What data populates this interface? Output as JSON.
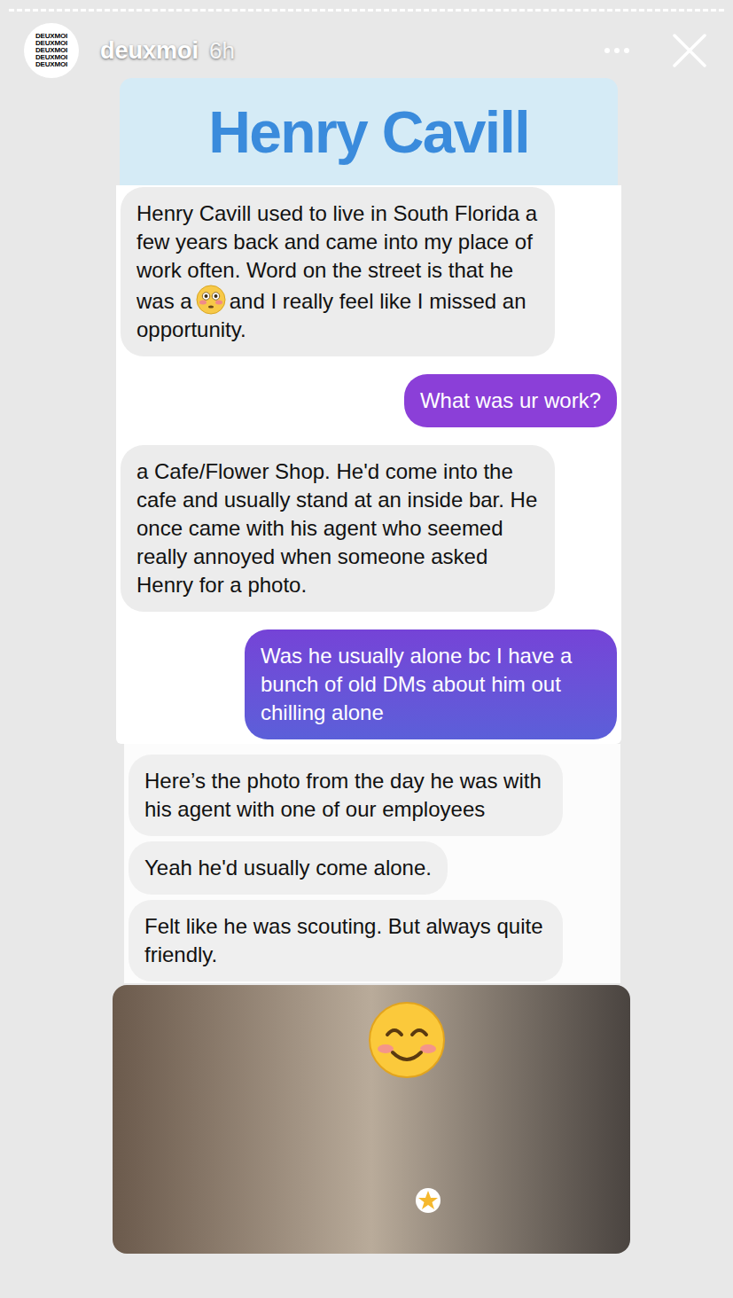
{
  "header": {
    "avatar_lines": [
      "DEUXMOI",
      "DEUXMOI",
      "DEUXMOI",
      "DEUXMOI",
      "DEUXMOI"
    ],
    "username": "deuxmoi",
    "time": "6h"
  },
  "title": "Henry Cavill",
  "panels": [
    {
      "messages": [
        {
          "from": "them",
          "parts": [
            "Henry Cavill used to live in South Florida a few years back and came into my place of work often. Word on the street is that he was a",
            "and I really feel like I missed an opportunity."
          ]
        },
        {
          "from": "me",
          "parts": [
            "What was ur work?"
          ]
        },
        {
          "from": "them",
          "parts": [
            "a Cafe/Flower Shop. He'd come into the cafe and usually stand at an inside bar. He once came with his agent who seemed really annoyed when someone asked Henry for a photo."
          ]
        },
        {
          "from": "me",
          "parts": [
            "Was he usually alone bc I have a bunch of old DMs about him out chilling alone"
          ]
        }
      ]
    },
    {
      "messages": [
        {
          "from": "them",
          "parts": [
            "Here’s the photo from the day he was with his agent with one of our employees"
          ]
        },
        {
          "from": "them",
          "parts": [
            "Yeah he'd usually come alone."
          ]
        },
        {
          "from": "them",
          "parts": [
            "Felt like he was scouting. But always quite friendly."
          ]
        }
      ]
    }
  ]
}
